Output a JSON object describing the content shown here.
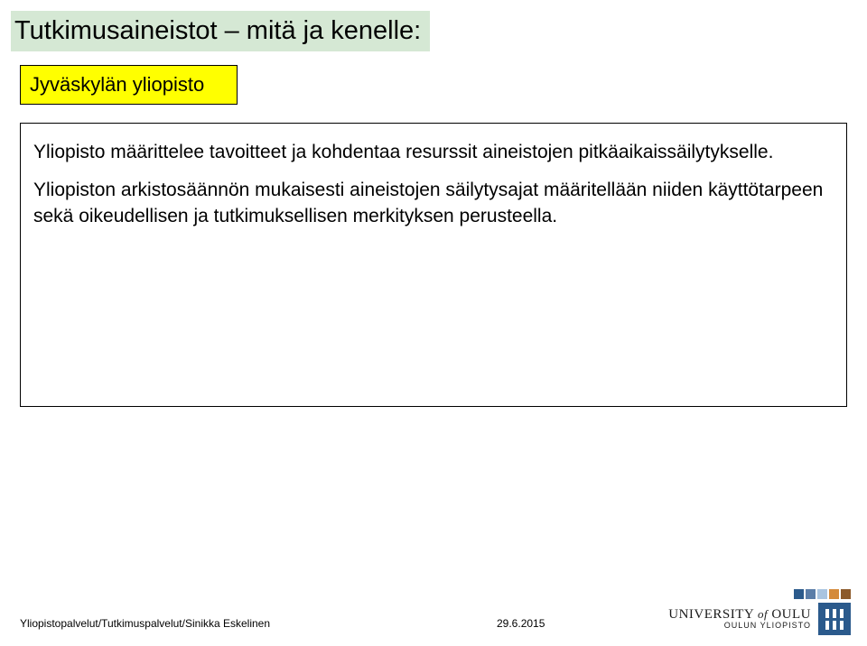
{
  "title": "Tutkimusaineistot – mitä ja kenelle:",
  "subtitle": "Jyväskylän yliopisto",
  "content": {
    "para1": "Yliopisto määrittelee tavoitteet ja kohdentaa resurssit aineistojen pitkäaikaissäilytykselle.",
    "para2": "Yliopiston arkistosäännön mukaisesti aineistojen säilytysajat määritellään niiden käyttötarpeen sekä oikeudellisen ja tutkimuksellisen merkityksen perusteella."
  },
  "footer": {
    "left": "Yliopistopalvelut/Tutkimuspalvelut/Sinikka Eskelinen",
    "date": "29.6.2015"
  },
  "logo": {
    "line1_a": "UNIVERSITY",
    "line1_of": "of",
    "line1_b": "OULU",
    "line2": "OULUN YLIOPISTO"
  },
  "decor_colors": [
    "#2b5a8c",
    "#5a7da8",
    "#a9c4e0",
    "#d48a3a",
    "#8c5a2b"
  ]
}
